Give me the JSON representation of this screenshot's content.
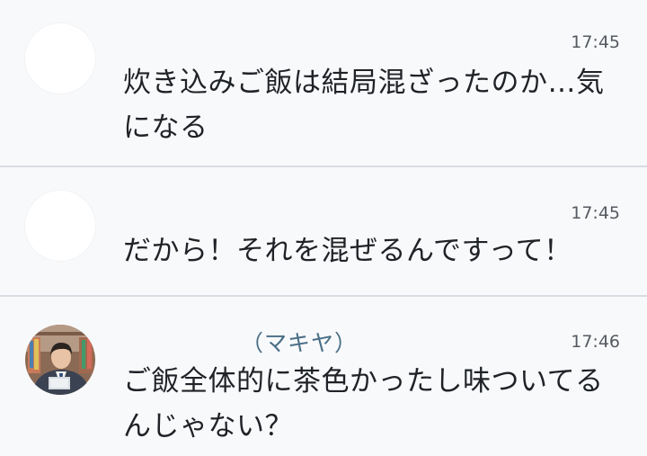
{
  "messages": [
    {
      "time": "17:45",
      "text_line1": "炊き込みご飯は結局混ざったのか…気",
      "text_line2": "になる"
    },
    {
      "time": "17:45",
      "text_line1": "だから！それを混ぜるんですって！"
    },
    {
      "name": "（マキヤ）",
      "time": "17:46",
      "text_line1": "ご飯全体的に茶色かったし味ついてる",
      "text_line2": "んじゃない？"
    }
  ],
  "colors": {
    "background": "#f8f9fb",
    "divider": "#d9dce2",
    "name": "#4a6e86",
    "text": "#1f2226",
    "time": "#555a61"
  }
}
